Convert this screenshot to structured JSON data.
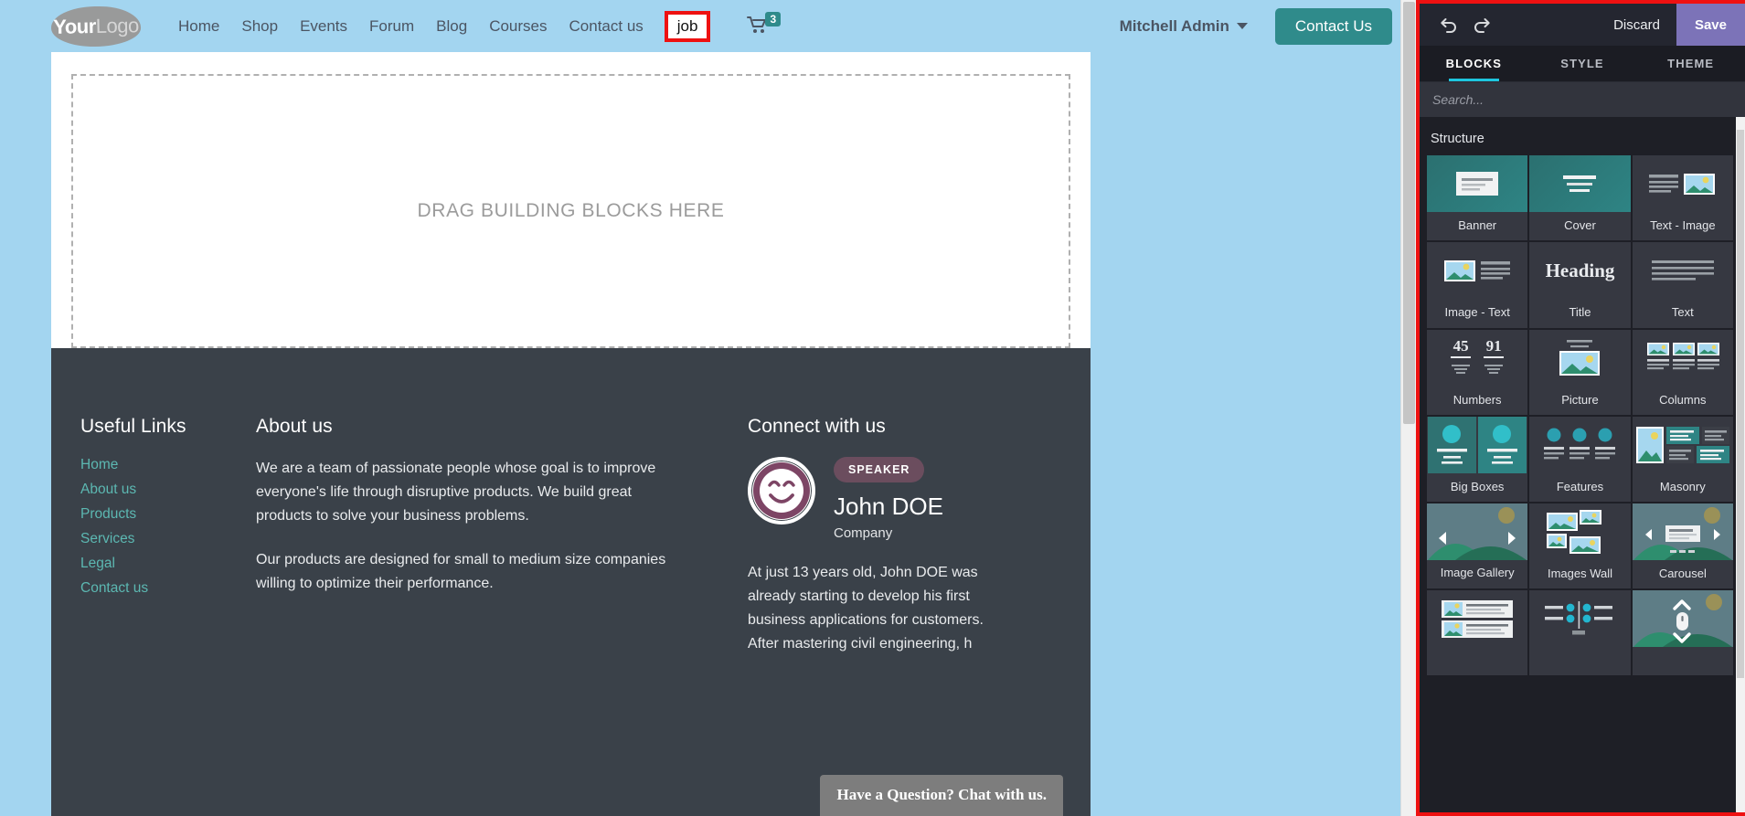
{
  "site": {
    "logo": {
      "bold": "Your",
      "light": "Logo"
    },
    "nav": [
      {
        "label": "Home"
      },
      {
        "label": "Shop"
      },
      {
        "label": "Events"
      },
      {
        "label": "Forum"
      },
      {
        "label": "Blog"
      },
      {
        "label": "Courses"
      },
      {
        "label": "Contact us"
      }
    ],
    "highlighted_nav": {
      "label": "job",
      "outline_color": "#ee1111"
    },
    "cart": {
      "icon": "cart-icon",
      "count": "3",
      "badge_color": "#2f8b8b"
    },
    "user": {
      "name": "Mitchell Admin",
      "icon": "chevron-down-icon"
    },
    "cta": {
      "label": "Contact Us",
      "color": "#2f8b8b"
    },
    "dropzone": {
      "label": "DRAG BUILDING BLOCKS HERE"
    },
    "footer": {
      "links_heading": "Useful Links",
      "links": [
        "Home",
        "About us",
        "Products",
        "Services",
        "Legal",
        "Contact us"
      ],
      "about_heading": "About us",
      "about_p1": "We are a team of passionate people whose goal is to improve everyone's life through disruptive products. We build great products to solve your business problems.",
      "about_p2": "Our products are designed for small to medium size companies willing to optimize their performance.",
      "connect_heading": "Connect with us",
      "speaker_badge": "SPEAKER",
      "person_name": "John DOE",
      "person_company": "Company",
      "person_bio": "At just 13 years old, John DOE was already starting to develop his first business applications for customers. After mastering civil engineering, h",
      "link_color": "#5cb8b2",
      "bg_color": "#3a4149"
    },
    "chat": {
      "label": "Have a Question? Chat with us."
    }
  },
  "editor": {
    "toolbar": {
      "undo_icon": "undo-icon",
      "redo_icon": "redo-icon",
      "discard_label": "Discard",
      "save_label": "Save",
      "save_color": "#7c73b8"
    },
    "tabs": [
      {
        "label": "BLOCKS",
        "active": true
      },
      {
        "label": "STYLE",
        "active": false
      },
      {
        "label": "THEME",
        "active": false
      }
    ],
    "active_tab_underline": "#1ec6de",
    "search": {
      "placeholder": "Search...",
      "value": ""
    },
    "section_title": "Structure",
    "blocks": [
      {
        "label": "Banner",
        "thumb": "banner-thumb"
      },
      {
        "label": "Cover",
        "thumb": "cover-thumb"
      },
      {
        "label": "Text - Image",
        "thumb": "text-image-thumb"
      },
      {
        "label": "Image - Text",
        "thumb": "image-text-thumb"
      },
      {
        "label": "Title",
        "thumb": "title-thumb"
      },
      {
        "label": "Text",
        "thumb": "text-thumb"
      },
      {
        "label": "Numbers",
        "thumb": "numbers-thumb"
      },
      {
        "label": "Picture",
        "thumb": "picture-thumb"
      },
      {
        "label": "Columns",
        "thumb": "columns-thumb"
      },
      {
        "label": "Big Boxes",
        "thumb": "big-boxes-thumb"
      },
      {
        "label": "Features",
        "thumb": "features-thumb"
      },
      {
        "label": "Masonry",
        "thumb": "masonry-thumb"
      },
      {
        "label": "Image Gallery",
        "thumb": "image-gallery-thumb"
      },
      {
        "label": "Images Wall",
        "thumb": "images-wall-thumb"
      },
      {
        "label": "Carousel",
        "thumb": "carousel-thumb"
      },
      {
        "label": "",
        "thumb": "media-list-thumb"
      },
      {
        "label": "",
        "thumb": "comparisons-thumb"
      },
      {
        "label": "",
        "thumb": "parallax-thumb"
      }
    ],
    "numbers_thumb_values": {
      "left": "45",
      "right": "91"
    },
    "title_thumb_text": "Heading",
    "panel_outline_color": "#ee1111"
  }
}
